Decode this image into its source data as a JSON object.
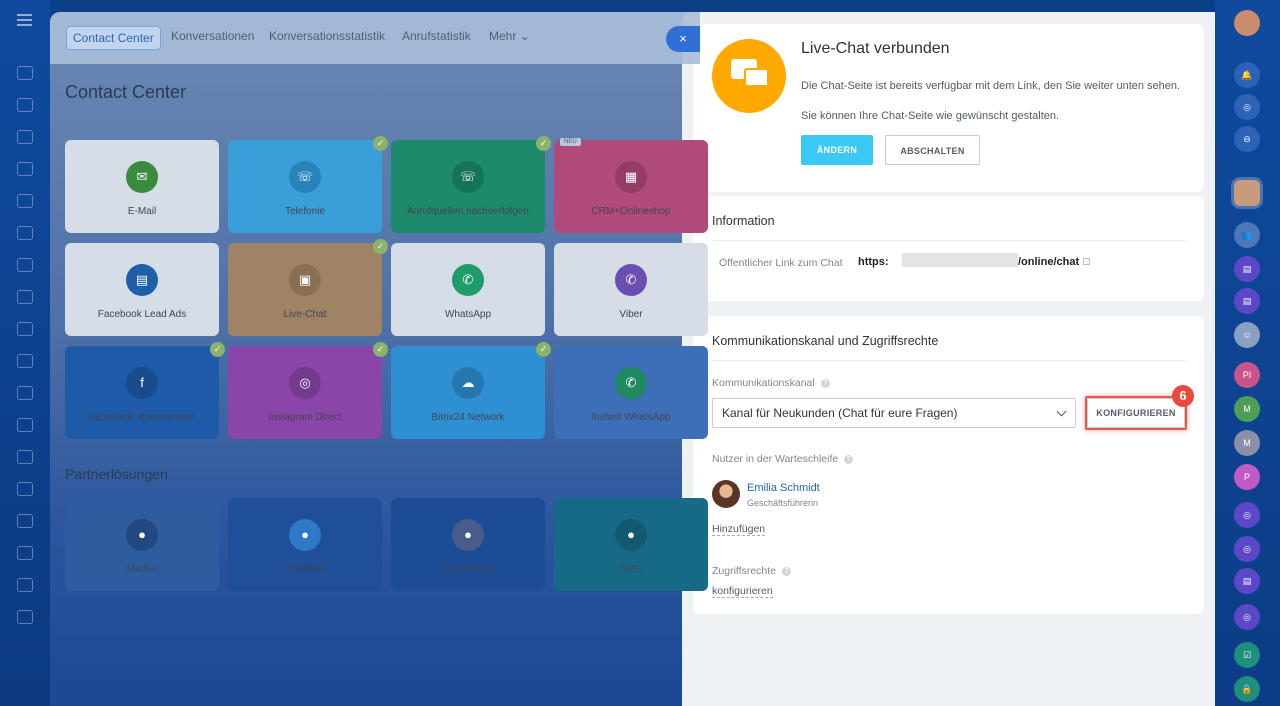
{
  "background": {
    "tabs": [
      "Contact Center",
      "Konversationen",
      "Konversationsstatistik",
      "Anrufstatistik",
      "Mehr"
    ],
    "close_label": "×",
    "page_title": "Contact Center",
    "tiles": [
      {
        "label": "E-Mail",
        "icon": "mail-icon",
        "color": "#d5dde7",
        "circle": "#3b8b3f",
        "glyph": "✉",
        "checked": false
      },
      {
        "label": "Telefonie",
        "icon": "phone-icon",
        "color": "#3a9fd8",
        "circle": "#2a82bb",
        "glyph": "☏",
        "checked": true
      },
      {
        "label": "Anrufquellen nachverfolgen",
        "icon": "call-tracking-icon",
        "color": "#1d8a6c",
        "circle": "#15735a",
        "glyph": "☏",
        "checked": true
      },
      {
        "label": "CRM+Onlineshop",
        "icon": "store-icon",
        "color": "#b04a7a",
        "circle": "#953b66",
        "glyph": "▦",
        "checked": false,
        "badge": "NEU"
      },
      {
        "label": "Facebook Lead Ads",
        "icon": "facebook-lead-icon",
        "color": "#d5dde7",
        "circle": "#1e5fa8",
        "glyph": "▤",
        "checked": false
      },
      {
        "label": "Live-Chat",
        "icon": "livechat-icon",
        "color": "#a08364",
        "circle": "#8a6f53",
        "glyph": "▣",
        "checked": true
      },
      {
        "label": "WhatsApp",
        "icon": "whatsapp-icon",
        "color": "#d5dde7",
        "circle": "#1f9c6a",
        "glyph": "✆",
        "checked": false
      },
      {
        "label": "Viber",
        "icon": "viber-icon",
        "color": "#d5dde7",
        "circle": "#6a4fb0",
        "glyph": "✆",
        "checked": false
      },
      {
        "label": "Facebook: Kommentare",
        "icon": "facebook-comments-icon",
        "color": "#1e5aa7",
        "circle": "#184c8d",
        "glyph": "f",
        "checked": true
      },
      {
        "label": "Instagram Direct",
        "icon": "instagram-icon",
        "color": "#8a45a8",
        "circle": "#743a8d",
        "glyph": "◎",
        "checked": true
      },
      {
        "label": "Bitrix24 Network",
        "icon": "network-icon",
        "color": "#2f8fd3",
        "circle": "#2677b0",
        "glyph": "☁",
        "checked": true
      },
      {
        "label": "Instant WhatsApp",
        "icon": "instant-whatsapp-icon",
        "color": "#3d6fb8",
        "circle": "#1f8a60",
        "glyph": "✆",
        "checked": false
      }
    ],
    "partner_title": "Partnerlösungen",
    "partner_tiles": [
      {
        "label": "Market",
        "icon": "market-icon",
        "color": "#2e5d9f",
        "circle": "#22497f"
      },
      {
        "label": "Chatbots",
        "icon": "chatbot-icon",
        "color": "#1f4f99",
        "circle": "#2f78c8"
      },
      {
        "label": "Sprachbots",
        "icon": "voicebot-icon",
        "color": "#1d4c96",
        "circle": "#4a5a8a"
      },
      {
        "label": "SMS",
        "icon": "sms-icon",
        "color": "#166a86",
        "circle": "#12586f"
      }
    ]
  },
  "panel": {
    "header": {
      "title": "Live-Chat verbunden",
      "line1": "Die Chat-Seite ist bereits verfügbar mit dem Link, den Sie weiter unten sehen.",
      "line2": "Sie können Ihre Chat-Seite wie gewünscht gestalten.",
      "change_label": "ÄNDERN",
      "disable_label": "ABSCHALTEN"
    },
    "info": {
      "title": "Information",
      "link_label": "Öffentlicher Link zum Chat",
      "link_prefix": "https:",
      "link_suffix": "/online/chat"
    },
    "channel": {
      "title": "Kommunikationskanal und Zugriffsrechte",
      "channel_label": "Kommunikationskanal",
      "channel_value": "Kanal für Neukunden (Chat für eure Fragen)",
      "configure_label": "KONFIGURIEREN",
      "step_number": "6",
      "queue_label": "Nutzer in der Warteschleife",
      "user_name": "Emilia Schmidt",
      "user_role": "Geschäftsführerin",
      "add_label": "Hinzufügen",
      "access_label": "Zugriffsrechte",
      "access_link": "konfigurieren"
    }
  },
  "right_rail": [
    {
      "icon": "avatar-icon",
      "color": "#c98d6b",
      "text": ""
    },
    {
      "icon": "bell-icon",
      "color": "#2d62b8",
      "text": "🔔"
    },
    {
      "icon": "spiral-icon",
      "color": "#2d62b8",
      "text": "◎"
    },
    {
      "icon": "search-chat-icon",
      "color": "#2d62b8",
      "text": "⊖"
    },
    {
      "icon": "user-avatar-icon",
      "color": "#c79b7c",
      "text": ""
    },
    {
      "icon": "group-icon",
      "color": "#4d77b8",
      "text": "👥"
    },
    {
      "icon": "chat-icon",
      "color": "#5b48c8",
      "text": "▤"
    },
    {
      "icon": "chat-icon",
      "color": "#5b48c8",
      "text": "▤"
    },
    {
      "icon": "bot-icon",
      "color": "#8aa0c0",
      "text": "☺"
    },
    {
      "icon": "avatar-pi",
      "color": "#c9548a",
      "text": "PI"
    },
    {
      "icon": "avatar-m",
      "color": "#4f9e57",
      "text": "M"
    },
    {
      "icon": "avatar-m2",
      "color": "#8b8fa8",
      "text": "M"
    },
    {
      "icon": "avatar-p",
      "color": "#c05ac6",
      "text": "P"
    },
    {
      "icon": "spiral-icon",
      "color": "#5b48c8",
      "text": "◎"
    },
    {
      "icon": "spiral-icon",
      "color": "#5b48c8",
      "text": "◎"
    },
    {
      "icon": "chat-icon",
      "color": "#5b48c8",
      "text": "▤"
    },
    {
      "icon": "spiral-icon",
      "color": "#5b48c8",
      "text": "◎"
    },
    {
      "icon": "task-icon",
      "color": "#1e8f7a",
      "text": "☑"
    },
    {
      "icon": "lock-icon",
      "color": "#1e8f7a",
      "text": "🔒"
    }
  ]
}
